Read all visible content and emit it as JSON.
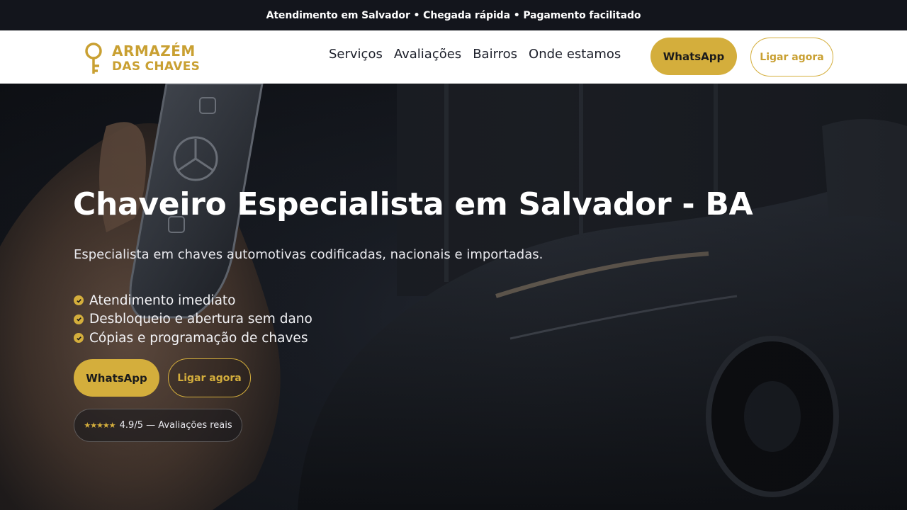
{
  "topbar": {
    "text": "Atendimento em Salvador • Chegada rápida • Pagamento facilitado"
  },
  "header": {
    "logo": {
      "line1": "ARMAZÉM",
      "line2": "DAS CHAVES",
      "icon": "key-icon"
    },
    "nav": [
      "Serviços",
      "Avaliações",
      "Bairros",
      "Onde estamos"
    ],
    "whatsapp_label": "WhatsApp",
    "call_label": "Ligar agora"
  },
  "hero": {
    "title": "Chaveiro Especialista em Salvador - BA",
    "subtitle": "Especialista em chaves automotivas codificadas, nacionais e importadas.",
    "bullets": [
      "Atendimento imediato",
      "Desbloqueio e abertura sem dano",
      "Cópias e programação de chaves"
    ],
    "whatsapp_label": "WhatsApp",
    "call_label": "Ligar agora",
    "rating": {
      "stars": "★★★★★",
      "text": "4.9/5 — Avaliações reais",
      "value": 4.9,
      "max": 5
    }
  },
  "colors": {
    "accent": "#d4ae3c",
    "dark": "#13151c",
    "white": "#ffffff"
  }
}
